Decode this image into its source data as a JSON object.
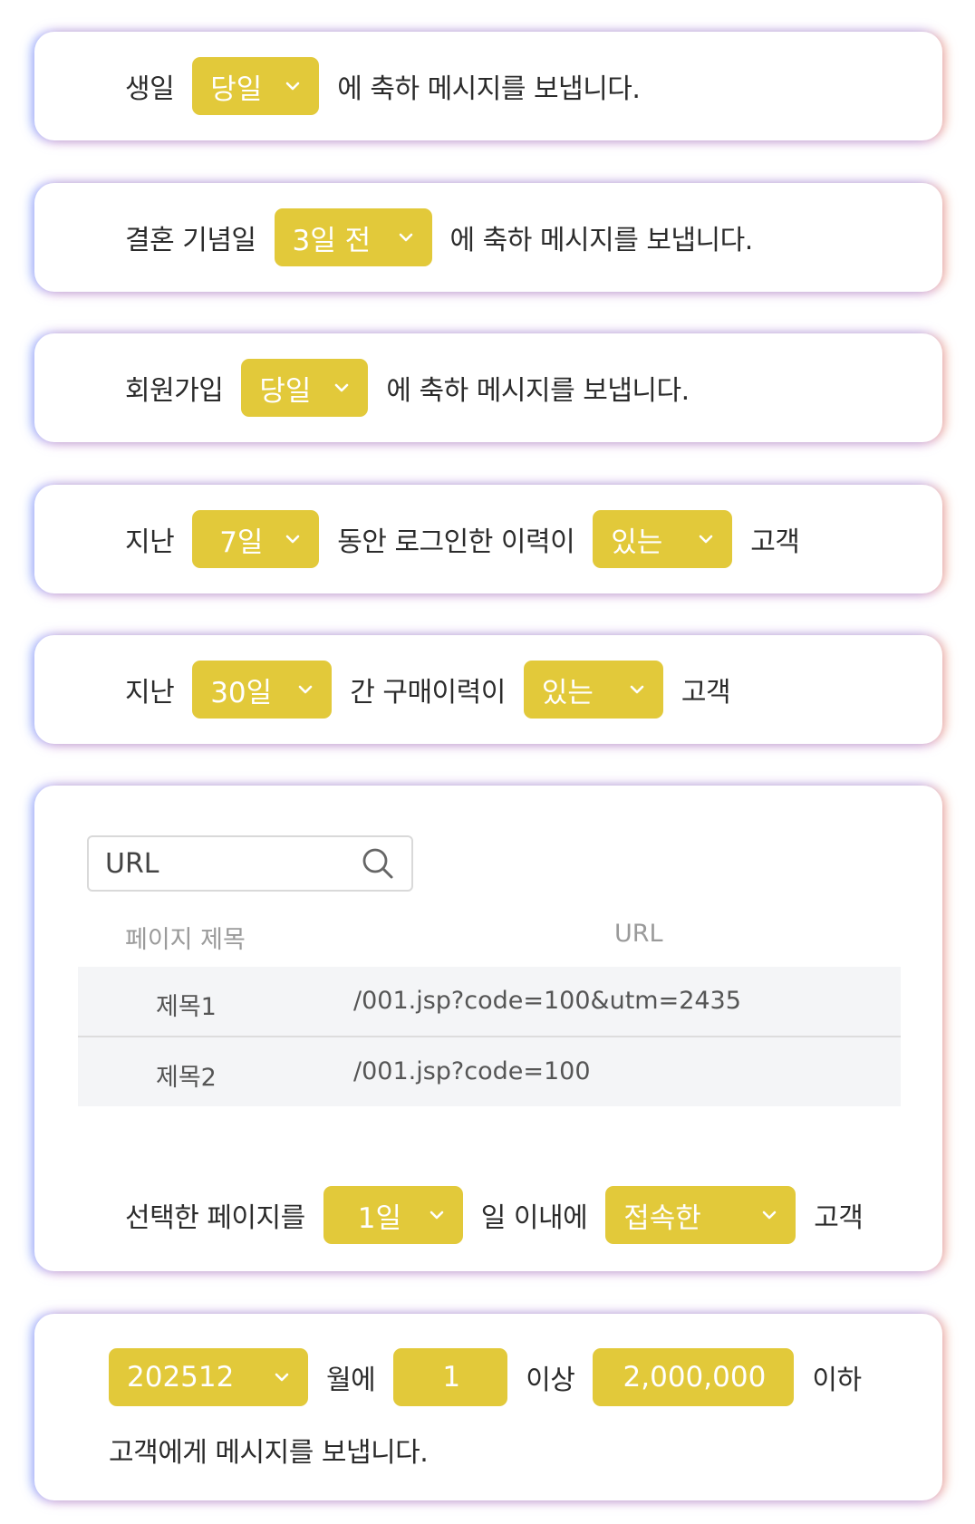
{
  "rules": [
    {
      "label": "생일",
      "option": "당일",
      "suffix": "에 축하 메시지를 보냅니다."
    },
    {
      "label": "결혼 기념일",
      "option": "3일 전",
      "suffix": "에 축하 메시지를 보냅니다."
    },
    {
      "label": "회원가입",
      "option": "당일",
      "suffix": "에 축하 메시지를 보냅니다."
    }
  ],
  "login": {
    "prefix": "지난",
    "period": "7일",
    "middle": "동안 로그인한 이력이",
    "status": "있는",
    "suffix": "고객"
  },
  "purchase": {
    "prefix": "지난",
    "period": "30일",
    "middle": "간 구매이력이",
    "status": "있는",
    "suffix": "고객"
  },
  "page_visit": {
    "search_placeholder": "URL",
    "table": {
      "headers": [
        "페이지 제목",
        "URL"
      ],
      "rows": [
        {
          "title": "제목1",
          "url": "/001.jsp?code=100&utm=2435"
        },
        {
          "title": "제목2",
          "url": "/001.jsp?code=100"
        }
      ]
    },
    "prefix": "선택한 페이지를",
    "period": "1일",
    "middle": "일 이내에",
    "action": "접속한",
    "suffix": "고객"
  },
  "monthly": {
    "month": "202512",
    "month_suffix": "월에",
    "min": "1",
    "min_suffix": "이상",
    "max": "2,000,000",
    "max_suffix": "이하",
    "footer": "고객에게 메시지를 보냅니다."
  },
  "colors": {
    "accent": "#e2c93a"
  }
}
